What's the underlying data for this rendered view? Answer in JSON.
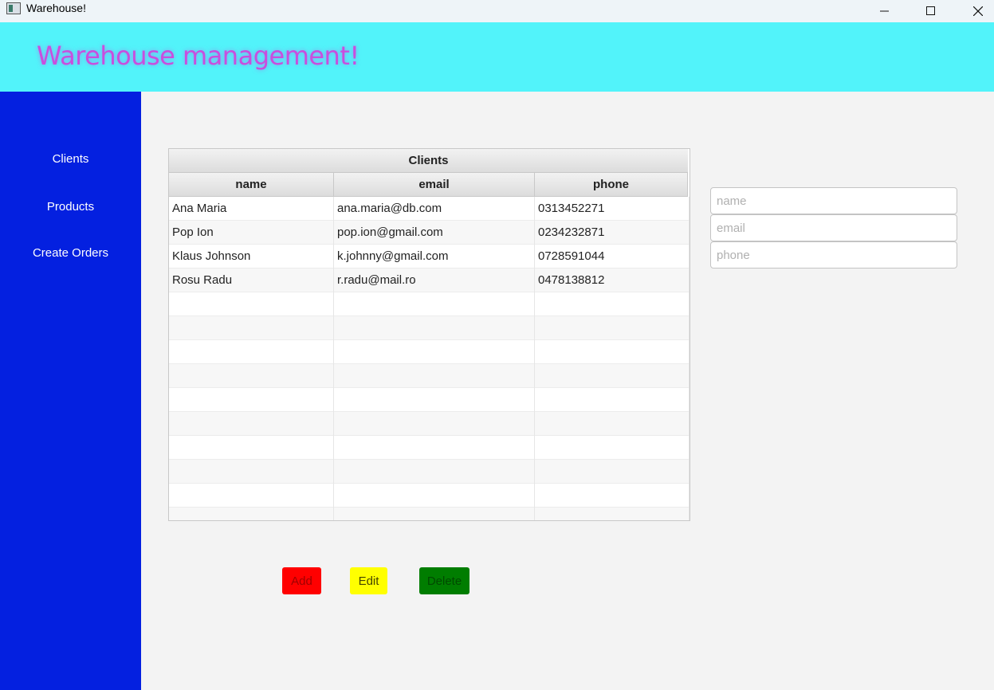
{
  "window": {
    "title": "Warehouse!",
    "controls": [
      "minimize-icon",
      "maximize-icon",
      "close-icon"
    ]
  },
  "header": {
    "title": "Warehouse management!",
    "background": "#52f3fa",
    "title_color": "#c94ede"
  },
  "sidebar": {
    "background": "#0420e0",
    "items": [
      {
        "label": "Clients"
      },
      {
        "label": "Products"
      },
      {
        "label": "Create Orders"
      }
    ]
  },
  "table": {
    "caption": "Clients",
    "columns": [
      "name",
      "email",
      "phone"
    ],
    "rows": [
      [
        "Ana Maria",
        "ana.maria@db.com",
        "0313452271"
      ],
      [
        "Pop Ion",
        "pop.ion@gmail.com",
        "0234232871"
      ],
      [
        "Klaus Johnson",
        "k.johnny@gmail.com",
        "0728591044"
      ],
      [
        "Rosu Radu",
        "r.radu@mail.ro",
        "0478138812"
      ]
    ]
  },
  "form": {
    "name_placeholder": "name",
    "email_placeholder": "email",
    "phone_placeholder": "phone",
    "name_value": "",
    "email_value": "",
    "phone_value": ""
  },
  "buttons": {
    "add_label": "Add",
    "edit_label": "Edit",
    "delete_label": "Delete",
    "add_color": "#ff0000",
    "edit_color": "#ffff00",
    "delete_color": "#007d00"
  }
}
